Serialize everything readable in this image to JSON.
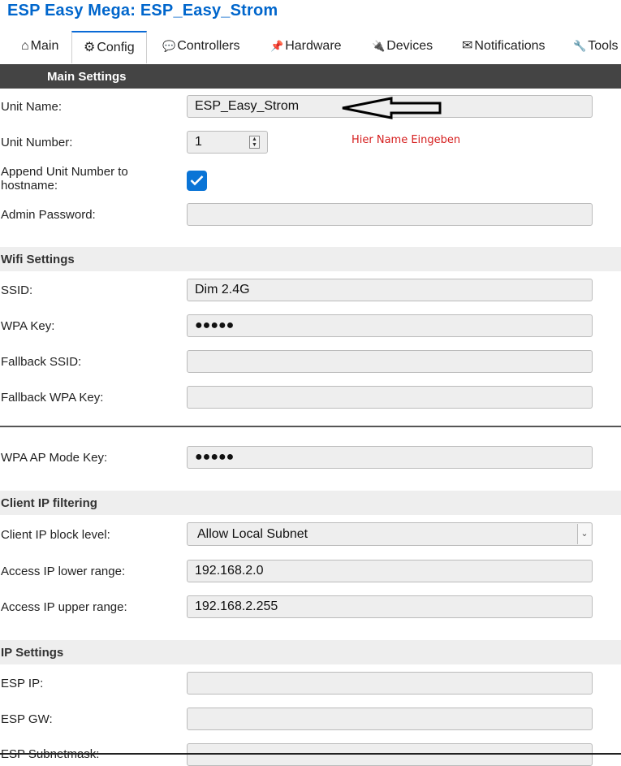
{
  "header": {
    "title": "ESP Easy Mega: ESP_Easy_Strom"
  },
  "tabs": [
    {
      "icon": "⌂",
      "label": "Main"
    },
    {
      "icon": "⚙",
      "label": "Config"
    },
    {
      "icon": "💬",
      "label": "Controllers"
    },
    {
      "icon": "📌",
      "label": "Hardware"
    },
    {
      "icon": "🔌",
      "label": "Devices"
    },
    {
      "icon": "✉",
      "label": "Notifications"
    },
    {
      "icon": "🔧",
      "label": "Tools"
    }
  ],
  "active_tab": "Config",
  "sections": {
    "main": "Main Settings",
    "wifi": "Wifi Settings",
    "client_ip": "Client IP filtering",
    "ip": "IP Settings"
  },
  "fields": {
    "unit_name": {
      "label": "Unit Name:",
      "value": "ESP_Easy_Strom"
    },
    "unit_number": {
      "label": "Unit Number:",
      "value": "1"
    },
    "append_unit": {
      "label": "Append Unit Number to hostname:",
      "checked": true
    },
    "admin_password": {
      "label": "Admin Password:",
      "value": ""
    },
    "ssid": {
      "label": "SSID:",
      "value": "Dim 2.4G"
    },
    "wpa_key": {
      "label": "WPA Key:",
      "value": "●●●●●"
    },
    "fallback_ssid": {
      "label": "Fallback SSID:",
      "value": ""
    },
    "fallback_wpa_key": {
      "label": "Fallback WPA Key:",
      "value": ""
    },
    "wpa_ap_mode_key": {
      "label": "WPA AP Mode Key:",
      "value": "●●●●●"
    },
    "client_ip_block": {
      "label": "Client IP block level:",
      "value": "Allow Local Subnet"
    },
    "access_ip_lower": {
      "label": "Access IP lower range:",
      "value": "192.168.2.0"
    },
    "access_ip_upper": {
      "label": "Access IP upper range:",
      "value": "192.168.2.255"
    },
    "esp_ip": {
      "label": "ESP IP:",
      "value": ""
    },
    "esp_gw": {
      "label": "ESP GW:",
      "value": ""
    },
    "esp_subnet": {
      "label": "ESP Subnetmask:",
      "value": ""
    }
  },
  "annotation": {
    "note": "Hier Name Eingeben"
  },
  "colors": {
    "title": "#0066cc",
    "active_tab_border": "#0a6ad6",
    "note": "#d62020",
    "checkbox": "#0a74d6"
  }
}
